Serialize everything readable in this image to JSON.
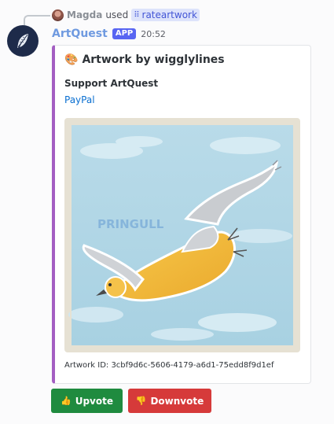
{
  "reply": {
    "user": "Magda",
    "used_text": "used",
    "command": "rateartwork"
  },
  "message": {
    "author": "ArtQuest",
    "badge": "APP",
    "timestamp": "20:52"
  },
  "embed": {
    "accent_color": "#a45fc2",
    "title_icon": "palette-icon",
    "title": "Artwork by wigglylines",
    "field_name": "Support ArtQuest",
    "field_link": "PayPal",
    "image_watermark": "PRINGULL",
    "footer": "Artwork ID: 3cbf9d6c-5606-4179-a6d1-75edd8f9d1ef"
  },
  "buttons": {
    "upvote": {
      "icon": "thumbs-up-icon",
      "label": "Upvote",
      "color": "#1f8b3f"
    },
    "downvote": {
      "icon": "thumbs-down-icon",
      "label": "Downvote",
      "color": "#d63a3a"
    }
  },
  "colors": {
    "author": "#6f9ae0",
    "app_badge": "#5865f2",
    "command_chip": "#dde3fb",
    "link": "#0a6fd1"
  }
}
